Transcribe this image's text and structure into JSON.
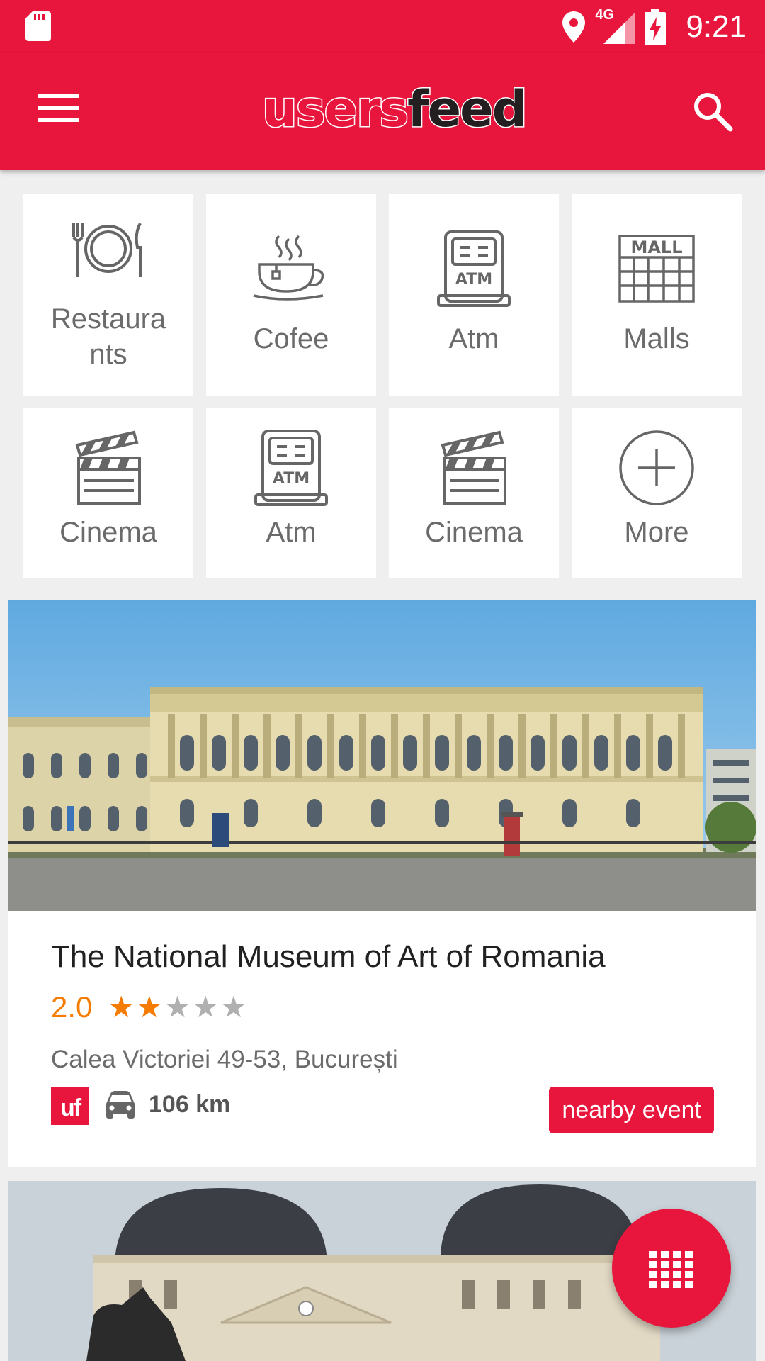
{
  "status_bar": {
    "network": "4G",
    "time": "9:21"
  },
  "app_bar": {
    "logo_part1": "users",
    "logo_part2": "feed"
  },
  "categories": [
    {
      "label": "Restaura nts",
      "icon": "fork-plate-knife-icon"
    },
    {
      "label": "Cofee",
      "icon": "coffee-cup-icon"
    },
    {
      "label": "Atm",
      "icon": "atm-icon"
    },
    {
      "label": "Malls",
      "icon": "mall-icon"
    },
    {
      "label": "Cinema",
      "icon": "clapperboard-icon"
    },
    {
      "label": "Atm",
      "icon": "atm-icon"
    },
    {
      "label": "Cinema",
      "icon": "clapperboard-icon"
    },
    {
      "label": "More",
      "icon": "plus-circle-icon"
    }
  ],
  "cards": [
    {
      "title": "The National Museum of Art of Romania",
      "rating": "2.0",
      "rating_stars": 2,
      "address": "Calea Victoriei 49-53, București",
      "badge": "uf",
      "distance": "106 km",
      "event_label": "nearby event"
    }
  ],
  "colors": {
    "brand": "#e8153c",
    "rating": "#f57c00",
    "star_off": "#b0b0b0"
  },
  "fab": {
    "icon": "grid-icon"
  }
}
